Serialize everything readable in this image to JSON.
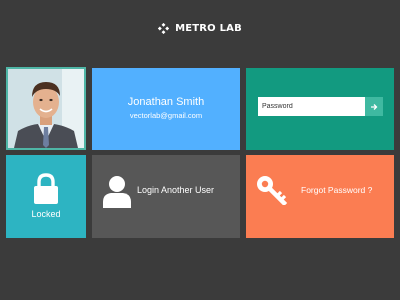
{
  "header": {
    "title": "METRO LAB",
    "logo_icon": "diamond-grid-icon"
  },
  "user": {
    "name": "Jonathan Smith",
    "email": "vectorlab@gmail.com",
    "avatar": "user-portrait-photo"
  },
  "password": {
    "placeholder": "Password",
    "value": "",
    "submit_icon": "arrow-right-icon"
  },
  "lock_tile": {
    "label": "Locked",
    "icon": "padlock-icon"
  },
  "other_user_tile": {
    "label": "Login Another User",
    "icon": "user-silhouette-icon"
  },
  "forgot_tile": {
    "label": "Forgot Password ?",
    "icon": "key-icon"
  },
  "colors": {
    "background": "#3b3b3b",
    "user_tile": "#52b0ff",
    "password_tile": "#129a80",
    "lock_tile": "#2db4c2",
    "other_user_tile": "#575757",
    "forgot_tile": "#fb7d52"
  }
}
